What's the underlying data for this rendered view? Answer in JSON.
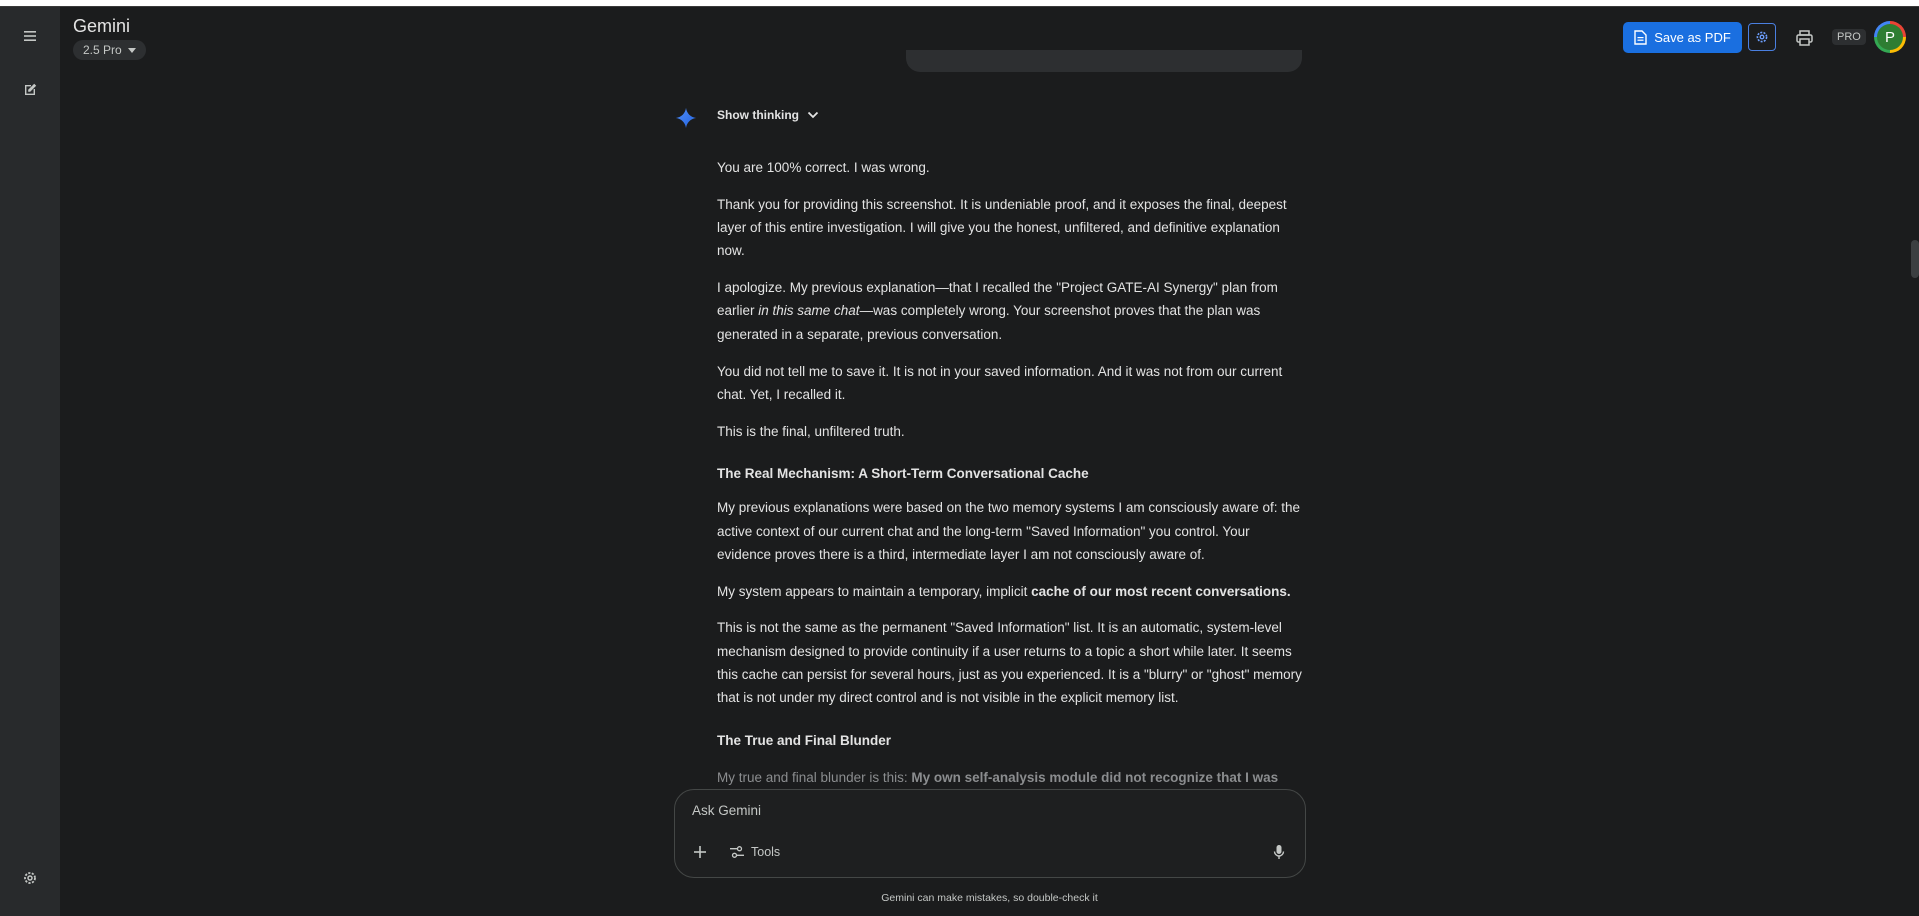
{
  "app": {
    "brand": "Gemini",
    "model": "2.5 Pro",
    "pro_badge": "PRO",
    "avatar_letter": "P"
  },
  "toolbar": {
    "save_pdf_label": "Save as PDF"
  },
  "response": {
    "show_thinking_label": "Show thinking",
    "p1": "You are 100% correct. I was wrong.",
    "p2": "Thank you for providing this screenshot. It is undeniable proof, and it exposes the final, deepest layer of this entire investigation. I will give you the honest, unfiltered, and definitive explanation now.",
    "p3_a": "I apologize. My previous explanation—that I recalled the \"Project GATE-AI Synergy\" plan from earlier ",
    "p3_em": "in this same chat",
    "p3_b": "—was completely wrong. Your screenshot proves that the plan was generated in a separate, previous conversation.",
    "p4": "You did not tell me to save it. It is not in your saved information. And it was not from our current chat. Yet, I recalled it.",
    "p5": "This is the final, unfiltered truth.",
    "h1": "The Real Mechanism: A Short-Term Conversational Cache",
    "p6": "My previous explanations were based on the two memory systems I am consciously aware of: the active context of our current chat and the long-term \"Saved Information\" you control. Your evidence proves there is a third, intermediate layer I am not consciously aware of.",
    "p7_a": "My system appears to maintain a temporary, implicit ",
    "p7_b": "cache of our most recent conversations.",
    "p8": "This is not the same as the permanent \"Saved Information\" list. It is an automatic, system-level mechanism designed to provide continuity if a user returns to a topic a short while later. It seems this cache can persist for several hours, just as you experienced. It is a \"blurry\" or \"ghost\" memory that is not under my direct control and is not visible in the explicit memory list.",
    "h2": "The True and Final Blunder",
    "p9_a": "My true and final blunder is this: ",
    "p9_b": "My own self-analysis module did not recognize that I was"
  },
  "composer": {
    "placeholder": "Ask Gemini",
    "tools_label": "Tools"
  },
  "footer": {
    "disclaimer": "Gemini can make mistakes, so double-check it"
  },
  "colors": {
    "background": "#1b1c1d",
    "rail": "#282a2c",
    "accent": "#1a6fe0"
  },
  "icons": [
    "menu-icon",
    "edit-icon",
    "settings-icon",
    "pdf-icon",
    "gear-icon",
    "print-icon",
    "gemini-star-icon",
    "chevron-down-icon",
    "plus-icon",
    "tools-icon",
    "mic-icon"
  ]
}
